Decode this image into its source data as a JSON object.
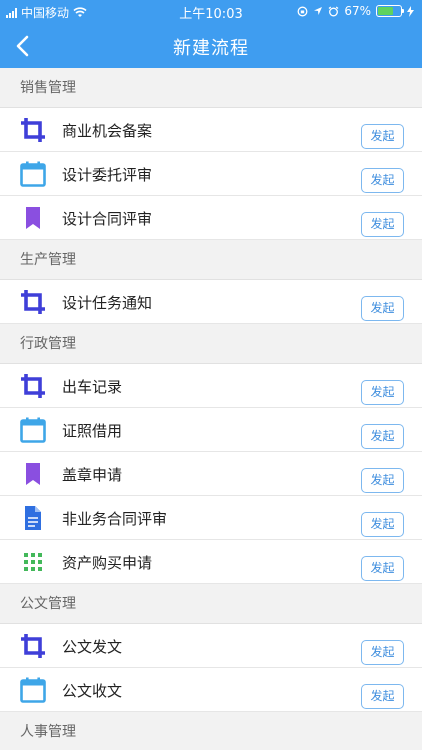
{
  "status_bar": {
    "carrier": "中国移动",
    "time": "上午10:03",
    "battery_percent": "67%",
    "battery_level": 0.67
  },
  "nav": {
    "title": "新建流程"
  },
  "colors": {
    "header": "#3f9df0",
    "crop_icon": "#3f3fd8",
    "calendar_icon": "#3ea6e8",
    "bookmark_icon": "#8a4fe0",
    "document_icon": "#2f6fe0",
    "grid_icon": "#43b85a"
  },
  "sections": [
    {
      "title": "销售管理",
      "items": [
        {
          "label": "商业机会备案",
          "icon": "crop-icon",
          "button": "发起"
        },
        {
          "label": "设计委托评审",
          "icon": "calendar-icon",
          "button": "发起"
        },
        {
          "label": "设计合同评审",
          "icon": "bookmark-icon",
          "button": "发起"
        }
      ]
    },
    {
      "title": "生产管理",
      "items": [
        {
          "label": "设计任务通知",
          "icon": "crop-icon",
          "button": "发起"
        }
      ]
    },
    {
      "title": "行政管理",
      "items": [
        {
          "label": "出车记录",
          "icon": "crop-icon",
          "button": "发起"
        },
        {
          "label": "证照借用",
          "icon": "calendar-icon",
          "button": "发起"
        },
        {
          "label": "盖章申请",
          "icon": "bookmark-icon",
          "button": "发起"
        },
        {
          "label": "非业务合同评审",
          "icon": "document-icon",
          "button": "发起"
        },
        {
          "label": "资产购买申请",
          "icon": "grid-icon",
          "button": "发起"
        }
      ]
    },
    {
      "title": "公文管理",
      "items": [
        {
          "label": "公文发文",
          "icon": "crop-icon",
          "button": "发起"
        },
        {
          "label": "公文收文",
          "icon": "calendar-icon",
          "button": "发起"
        }
      ]
    },
    {
      "title": "人事管理",
      "items": []
    }
  ]
}
